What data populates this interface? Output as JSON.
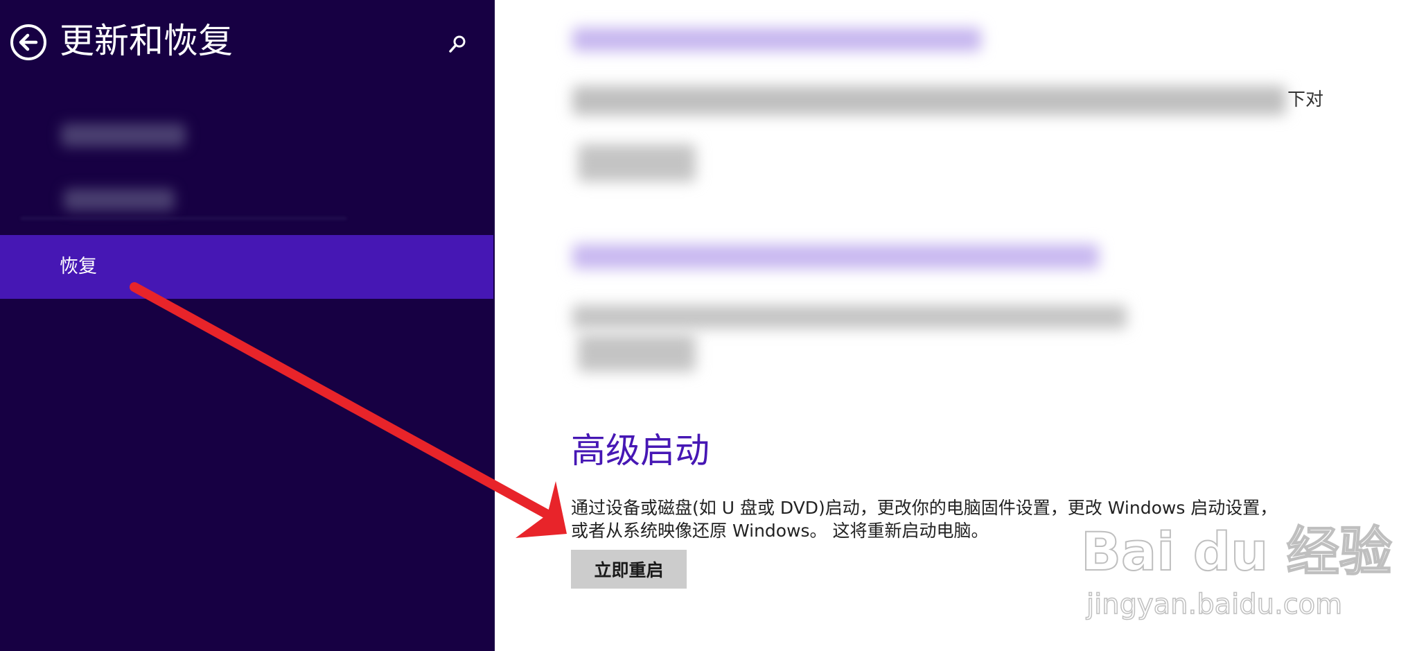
{
  "header": {
    "title": "更新和恢复",
    "back_icon": "back-arrow-icon",
    "search_icon": "search-icon"
  },
  "sidebar": {
    "selected_item": "恢复"
  },
  "right_panel": {
    "stray_text": "下对"
  },
  "advanced_startup": {
    "heading": "高级启动",
    "description_line1": "通过设备或磁盘(如 U 盘或 DVD)启动，更改你的电脑固件设置，更改 Windows 启动设置，",
    "description_line2": "或者从系统映像还原 Windows。   这将重新启动电脑。",
    "button_label": "立即重启"
  },
  "annotation": {
    "arrow_color": "#e8242a"
  },
  "watermark": {
    "brand": "Bai du 经验",
    "url": "jingyan.baidu.com"
  },
  "colors": {
    "sidebar_bg": "#170043",
    "selected_bg": "#4617b4",
    "accent": "#4617b4",
    "button_bg": "#cccccc"
  }
}
